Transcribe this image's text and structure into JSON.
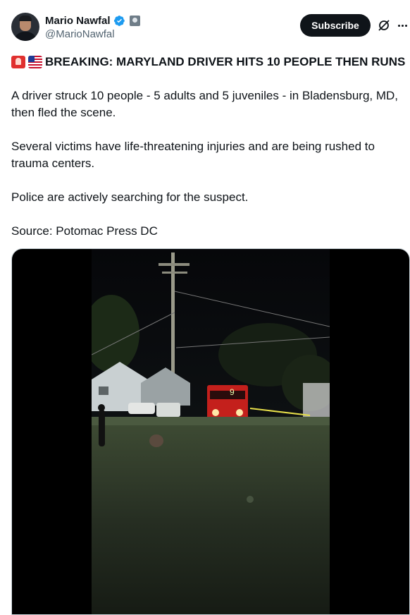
{
  "author": {
    "name": "Mario Nawfal",
    "handle": "@MarioNawfal",
    "verified_color": "#1d9bf0"
  },
  "actions": {
    "subscribe_label": "Subscribe",
    "grok_icon": "grok-icon",
    "more_icon": "more-icon"
  },
  "tweet": {
    "headline_emojis": [
      "rotating-light-emoji",
      "us-flag-emoji"
    ],
    "headline": "BREAKING: MARYLAND DRIVER HITS 10 PEOPLE THEN RUNS",
    "paragraphs": [
      "A driver struck 10 people - 5 adults and 5 juveniles - in Bladensburg, MD, then fled the scene.",
      "Several victims have life-threatening injuries and are being rushed to trauma centers.",
      "Police are actively searching for the suspect.",
      "Source: Potomac Press DC"
    ]
  },
  "media": {
    "type": "video",
    "fire_truck_number": "9"
  }
}
